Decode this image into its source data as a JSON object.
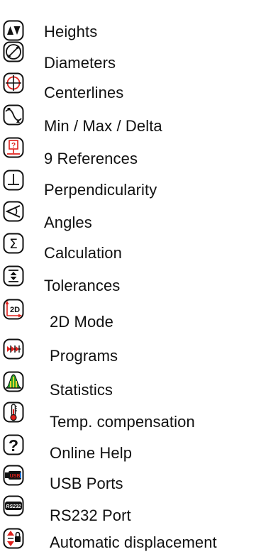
{
  "items": [
    {
      "label": "Heights",
      "icon": "heights-icon"
    },
    {
      "label": "Diameters",
      "icon": "diameter-icon"
    },
    {
      "label": "Centerlines",
      "icon": "centerline-icon"
    },
    {
      "label": "Min / Max / Delta",
      "icon": "min-max-icon"
    },
    {
      "label": "9 References",
      "icon": "references-icon"
    },
    {
      "label": "Perpendicularity",
      "icon": "perpendicular-icon"
    },
    {
      "label": "Angles",
      "icon": "angle-icon"
    },
    {
      "label": "Calculation",
      "icon": "sigma-icon"
    },
    {
      "label": "Tolerances",
      "icon": "tolerance-icon"
    },
    {
      "label": "2D Mode",
      "icon": "2d-mode-icon",
      "icon_text": "2D"
    },
    {
      "label": "Programs",
      "icon": "programs-icon"
    },
    {
      "label": "Statistics",
      "icon": "statistics-icon"
    },
    {
      "label": "Temp. compensation",
      "icon": "thermometer-icon"
    },
    {
      "label": "Online Help",
      "icon": "help-icon",
      "icon_text": "?"
    },
    {
      "label": "USB Ports",
      "icon": "usb-icon",
      "icon_text": "USB"
    },
    {
      "label": "RS232 Port",
      "icon": "rs232-icon",
      "icon_text": "RS232"
    },
    {
      "label": "Automatic displacement",
      "icon": "auto-displacement-icon"
    }
  ],
  "colors": {
    "accent_red": "#e0201b",
    "icon_stroke": "#111111",
    "stats_green": "#29a329",
    "stats_yellow": "#f2d22e",
    "usb_blue": "#1d6fd1"
  }
}
